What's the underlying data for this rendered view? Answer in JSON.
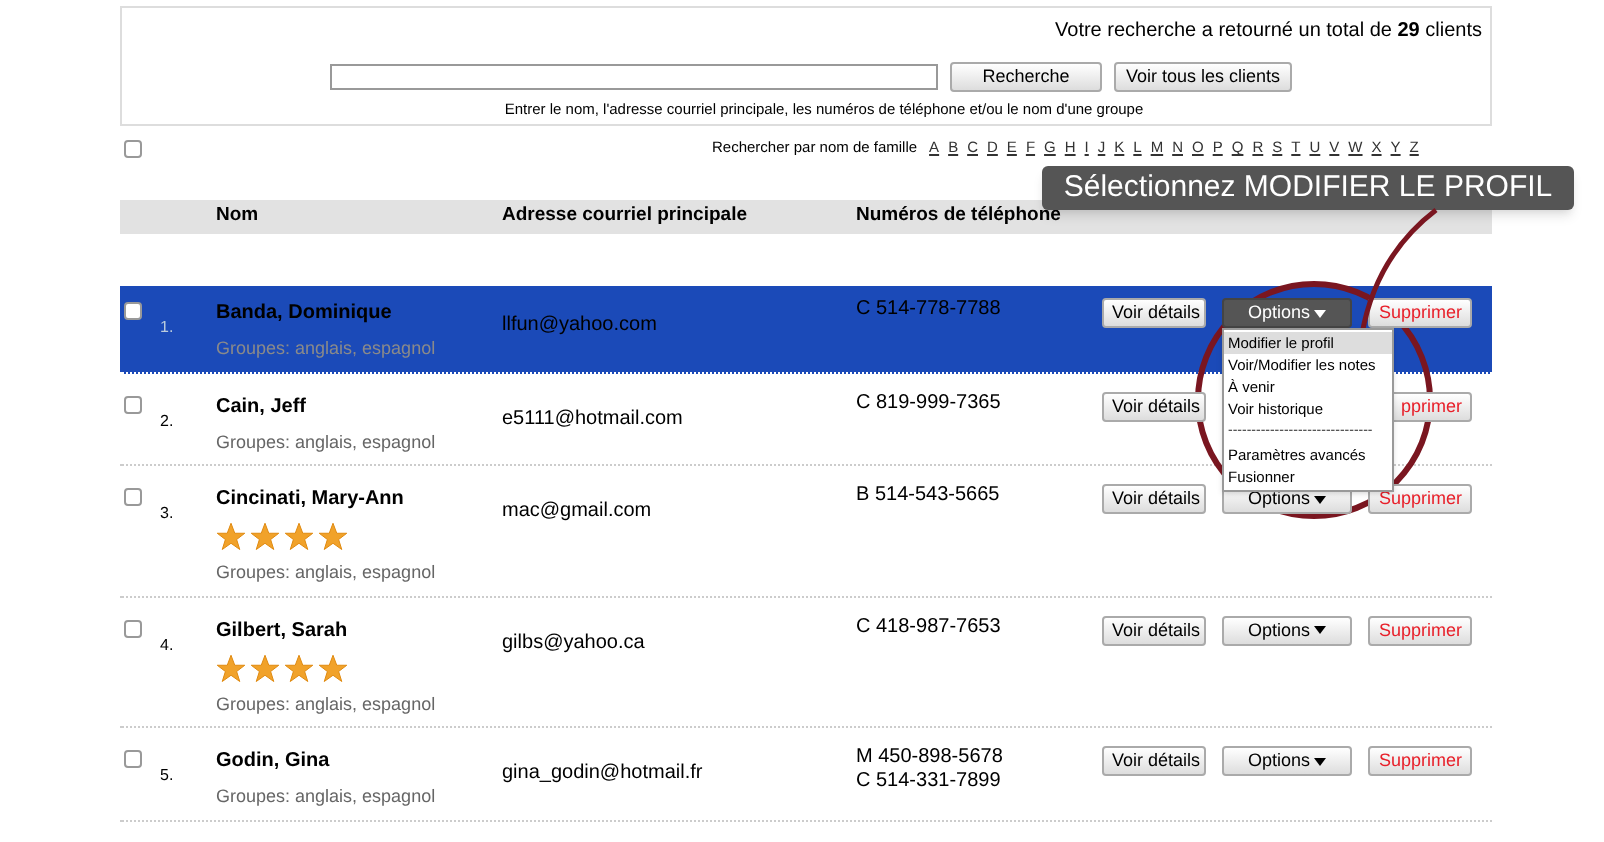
{
  "search": {
    "result_text": "Votre recherche a retourné un total de **29** clients",
    "search_button": "Recherche",
    "all_button": "Voir tous les clients",
    "hint": "Entrer le nom, l'adresse courriel principale, les numéros de téléphone et/ou le nom d'une groupe"
  },
  "filter": {
    "select_all_checked": false,
    "label": "Rechercher par nom de famille",
    "letters": [
      "A",
      "B",
      "C",
      "D",
      "E",
      "F",
      "G",
      "H",
      "I",
      "J",
      "K",
      "L",
      "M",
      "N",
      "O",
      "P",
      "Q",
      "R",
      "S",
      "T",
      "U",
      "V",
      "W",
      "X",
      "Y",
      "Z"
    ]
  },
  "callout": "Sélectionnez MODIFIER LE PROFIL",
  "table": {
    "columns": [
      "Nom",
      "Adresse courriel principale",
      "Numéros de téléphone"
    ],
    "rows": [
      {
        "selected": true,
        "checked": false,
        "number": "1.",
        "name": "Banda, Dominique",
        "email": "llfun@yahoo.com",
        "phones": [
          "C 514-778-7788"
        ],
        "groups": "Groupes: anglais, espagnol",
        "details": "Voir détails",
        "options": "Options",
        "options_open": true,
        "delete": "Supprimer"
      },
      {
        "selected": false,
        "checked": false,
        "number": "2.",
        "name": "Cain, Jeff",
        "email": "e5111@hotmail.com",
        "phones": [
          "C 819-999-7365"
        ],
        "groups": "Groupes: anglais, espagnol",
        "details": "Voir détails",
        "delete": "pprimer"
      },
      {
        "selected": false,
        "checked": false,
        "number": "3.",
        "name": "Cincinati, Mary-Ann",
        "email": "mac@gmail.com",
        "phones": [
          "B 514-543-5665"
        ],
        "stars": 4,
        "groups": "Groupes: anglais, espagnol",
        "details": "Voir détails",
        "options": "Options",
        "options_open": false,
        "delete": "Supprimer"
      },
      {
        "selected": false,
        "checked": false,
        "number": "4.",
        "name": "Gilbert, Sarah",
        "email": "gilbs@yahoo.ca",
        "phones": [
          "C 418-987-7653"
        ],
        "stars": 4,
        "groups": "Groupes: anglais, espagnol",
        "details": "Voir détails",
        "options": "Options",
        "options_open": false,
        "delete": "Supprimer"
      },
      {
        "selected": false,
        "checked": false,
        "number": "5.",
        "name": "Godin, Gina",
        "email": "gina_godin@hotmail.fr",
        "phones": [
          "M 450-898-5678",
          "C 514-331-7899"
        ],
        "groups": "Groupes: anglais, espagnol",
        "details": "Voir détails",
        "options": "Options",
        "options_open": false,
        "delete": "Supprimer"
      }
    ]
  },
  "options_menu": {
    "items": [
      {
        "kind": "item",
        "label": "Modifier le profil",
        "selected": true
      },
      {
        "kind": "item",
        "label": "Voir/Modifier les notes",
        "selected": false
      },
      {
        "kind": "item",
        "label": "À venir",
        "selected": false
      },
      {
        "kind": "item",
        "label": "Voir historique",
        "selected": false
      },
      {
        "kind": "separator",
        "label": "-------------------------------"
      },
      {
        "kind": "item",
        "label": "Paramètres avancés",
        "selected": false
      },
      {
        "kind": "item",
        "label": "Fusionner",
        "selected": false
      }
    ]
  }
}
